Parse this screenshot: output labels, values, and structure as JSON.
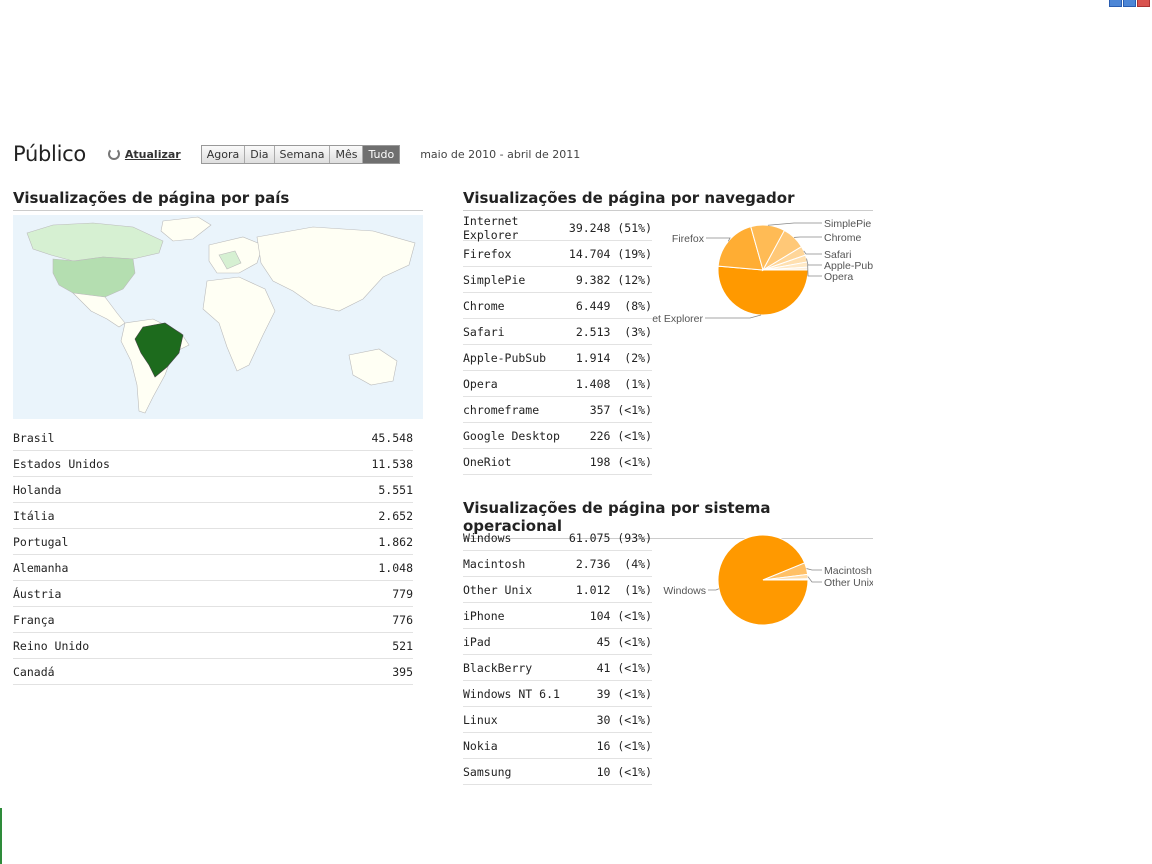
{
  "header": {
    "title": "Público",
    "refresh_label": "Atualizar",
    "ranges": [
      {
        "label": "Agora",
        "active": false
      },
      {
        "label": "Dia",
        "active": false
      },
      {
        "label": "Semana",
        "active": false
      },
      {
        "label": "Mês",
        "active": false
      },
      {
        "label": "Tudo",
        "active": true
      }
    ],
    "date_range": "maio de 2010 - abril de 2011"
  },
  "country": {
    "title": "Visualizações de página por país",
    "rows": [
      {
        "name": "Brasil",
        "value": "45.548"
      },
      {
        "name": "Estados Unidos",
        "value": "11.538"
      },
      {
        "name": "Holanda",
        "value": "5.551"
      },
      {
        "name": "Itália",
        "value": "2.652"
      },
      {
        "name": "Portugal",
        "value": "1.862"
      },
      {
        "name": "Alemanha",
        "value": "1.048"
      },
      {
        "name": "Áustria",
        "value": "779"
      },
      {
        "name": "França",
        "value": "776"
      },
      {
        "name": "Reino Unido",
        "value": "521"
      },
      {
        "name": "Canadá",
        "value": "395"
      }
    ]
  },
  "browser": {
    "title": "Visualizações de página por navegador",
    "rows": [
      {
        "name": "Internet Explorer",
        "value": "39.248 (51%)"
      },
      {
        "name": "Firefox",
        "value": "14.704 (19%)"
      },
      {
        "name": "SimplePie",
        "value": "9.382 (12%)"
      },
      {
        "name": "Chrome",
        "value": "6.449  (8%)"
      },
      {
        "name": "Safari",
        "value": "2.513  (3%)"
      },
      {
        "name": "Apple-PubSub",
        "value": "1.914  (2%)"
      },
      {
        "name": "Opera",
        "value": "1.408  (1%)"
      },
      {
        "name": "chromeframe",
        "value": "357 (<1%)"
      },
      {
        "name": "Google Desktop",
        "value": "226 (<1%)"
      },
      {
        "name": "OneRiot",
        "value": "198 (<1%)"
      }
    ],
    "pie": {
      "slices": [
        {
          "label": "Internet Explorer",
          "value": 39248,
          "color": "#ff9900"
        },
        {
          "label": "Firefox",
          "value": 14704,
          "color": "#ffad33"
        },
        {
          "label": "SimplePie",
          "value": 9382,
          "color": "#ffbb55"
        },
        {
          "label": "Chrome",
          "value": 6449,
          "color": "#ffc877"
        },
        {
          "label": "Safari",
          "value": 2513,
          "color": "#ffd699"
        },
        {
          "label": "Apple-PubSub",
          "value": 1914,
          "color": "#ffe0b0"
        },
        {
          "label": "Opera",
          "value": 1408,
          "color": "#ffe9c6"
        },
        {
          "label": "",
          "value": 781,
          "color": "#fff1dc"
        }
      ],
      "labels_shown": [
        "et Explorer",
        "Firefox",
        "SimplePie",
        "Chrome",
        "Safari",
        "Apple-Pub",
        "Opera"
      ]
    }
  },
  "os": {
    "title": "Visualizações de página por sistema operacional",
    "rows": [
      {
        "name": "Windows",
        "value": "61.075 (93%)"
      },
      {
        "name": "Macintosh",
        "value": "2.736  (4%)"
      },
      {
        "name": "Other Unix",
        "value": "1.012  (1%)"
      },
      {
        "name": "iPhone",
        "value": "104 (<1%)"
      },
      {
        "name": "iPad",
        "value": "45 (<1%)"
      },
      {
        "name": "BlackBerry",
        "value": "41 (<1%)"
      },
      {
        "name": "Windows NT 6.1",
        "value": "39 (<1%)"
      },
      {
        "name": "Linux",
        "value": "30 (<1%)"
      },
      {
        "name": "Nokia",
        "value": "16 (<1%)"
      },
      {
        "name": "Samsung",
        "value": "10 (<1%)"
      }
    ],
    "pie": {
      "slices": [
        {
          "label": "Windows",
          "value": 61075,
          "color": "#ff9900"
        },
        {
          "label": "Macintosh",
          "value": 2736,
          "color": "#ffc066"
        },
        {
          "label": "Other Unix",
          "value": 1012,
          "color": "#ffdca8"
        },
        {
          "label": "",
          "value": 285,
          "color": "#fff0da"
        }
      ],
      "labels_shown": [
        "Windows",
        "Macintosh",
        "Other Unix"
      ]
    }
  },
  "colors": {
    "map_ocean": "#eaf4fb",
    "map_land": "#fffff4",
    "map_highlight": "#1d6b1d",
    "map_medium": "#b4deb0",
    "map_light": "#d6f0d2"
  }
}
